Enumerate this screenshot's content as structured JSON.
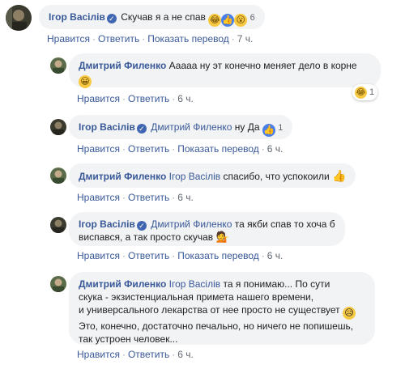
{
  "actions": {
    "like": "Нравится",
    "reply": "Ответить",
    "translate": "Показать перевод",
    "dot": "·"
  },
  "c1": {
    "author": "Ігор Васілів",
    "text": "Скучав я а не спав",
    "reactions": "6",
    "time": "7 ч."
  },
  "c2": {
    "author": "Дмитрий Филенко",
    "text": "Ааааа ну эт конечно меняет дело в корне",
    "reactions": "1",
    "time": "6 ч."
  },
  "c3": {
    "author": "Ігор Васілів",
    "mention": "Дмитрий Филенко",
    "text": "ну Да",
    "reactions": "1",
    "time": "6 ч."
  },
  "c4": {
    "author": "Дмитрий Филенко",
    "mention": "Ігор Васілів",
    "text": "спасибо, что успокоили",
    "time": "6 ч."
  },
  "c5": {
    "author": "Ігор Васілів",
    "mention": "Дмитрий Филенко",
    "text1": "та якби спав то хоча б",
    "text2": "виспався, а так просто скучав",
    "time": "6 ч."
  },
  "c6": {
    "author": "Дмитрий Филенко",
    "mention": "Ігор Васілів",
    "text1": "та я понимаю... По сути",
    "text2": "скука - экзистенциальная примета нашего времени,",
    "text3": "и универсального лекарства от нее просто не существует",
    "text4": "Это, конечно, достаточно печально, но ничего не попишешь,",
    "text5": "так устроен человек...",
    "time": "6 ч."
  }
}
